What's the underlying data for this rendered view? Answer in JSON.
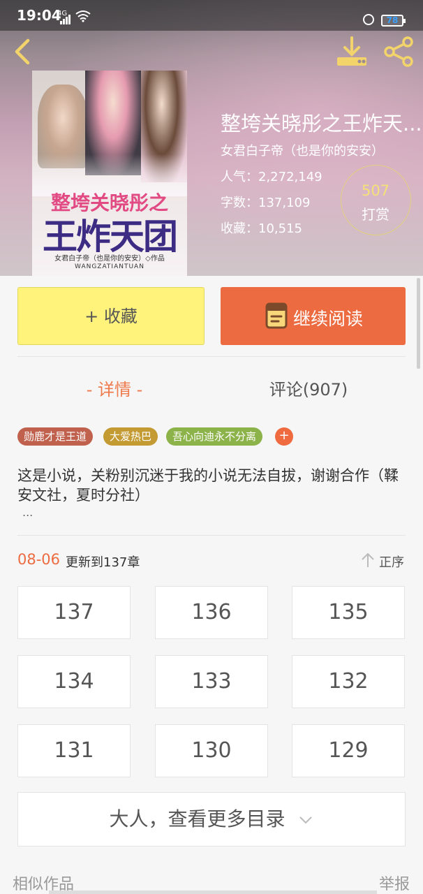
{
  "status_bar": {
    "time": "19:04",
    "network": "4G",
    "battery": "78"
  },
  "book": {
    "title": "整垮关晓彤之王炸天...",
    "author": "女君白子帝（也是你的安安）",
    "popularity": "人气：2,272,149",
    "word_count": "字数：137,109",
    "favorites": "收藏：10,515",
    "cover": {
      "title_line1": "整垮关晓彤之",
      "title_line2": "王炸天团",
      "author": "女君白子帝（也是你的安安）◇作品",
      "pinyin": "WANGZATIANTUAN"
    }
  },
  "reward": {
    "count": "507",
    "label": "打赏"
  },
  "actions": {
    "collect": "+ 收藏",
    "continue_read": "继续阅读"
  },
  "tabs": {
    "detail": "- 详情 -",
    "comments": "评论(907)"
  },
  "tags": [
    {
      "label": "勋鹿才是王道",
      "color": "#c0614e"
    },
    {
      "label": "大爱热巴",
      "color": "#c49b33"
    },
    {
      "label": "吾心向迪永不分离",
      "color": "#8cb24a"
    }
  ],
  "tag_add": "+",
  "description": "这是小说，关粉别沉迷于我的小说无法自拔，谢谢合作（鞣安文社，夏时分社）",
  "description_more": "...",
  "update": {
    "date": "08-06",
    "text": "更新到137章",
    "sort_label": "正序"
  },
  "chapters": [
    "137",
    "136",
    "135",
    "134",
    "133",
    "132",
    "131",
    "130",
    "129"
  ],
  "more_catalog": "大人，查看更多目录",
  "footer": {
    "similar": "相似作品",
    "report": "举报"
  },
  "colors": {
    "accent": "#ec6b40",
    "collect_bg": "#fff37c",
    "reward_ring": "#e2d080"
  }
}
